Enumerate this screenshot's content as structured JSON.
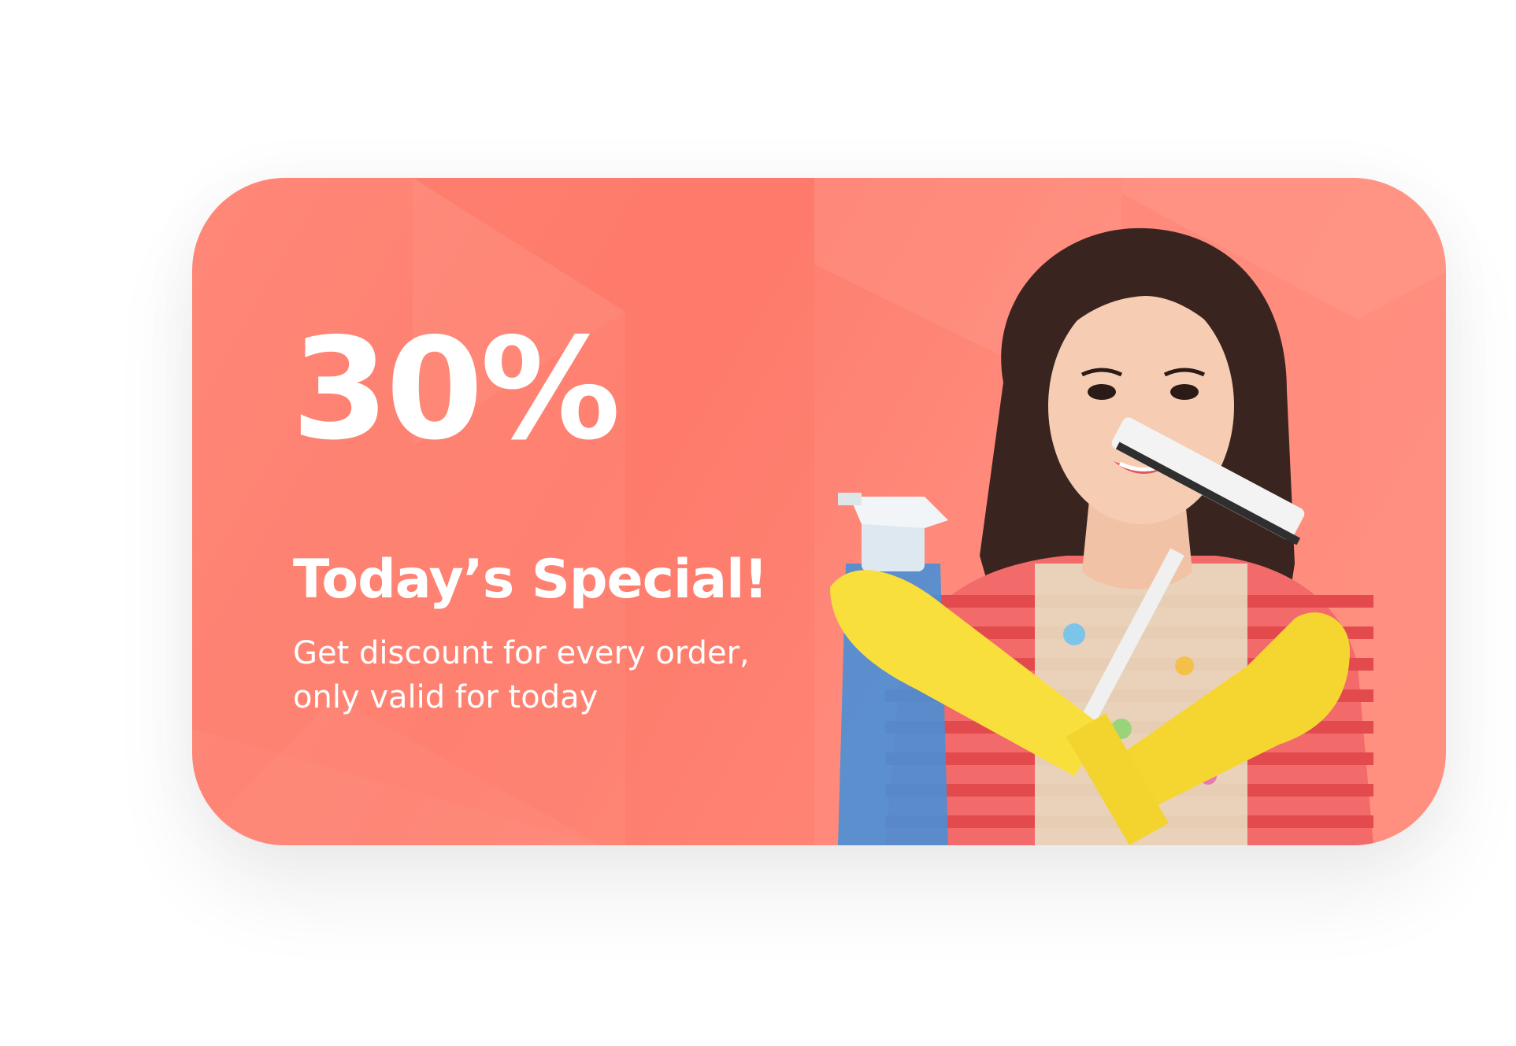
{
  "promo": {
    "discount": "30%",
    "headline": "Today’s Special!",
    "description": "Get discount for every order, only valid for today",
    "photo_alt": "woman in striped shirt and yellow gloves holding spray bottle and squeegee"
  },
  "colors": {
    "card_background": "#fd7d6e",
    "text": "#ffffff",
    "glove": "#f9df3c",
    "stripe": "#e9504f",
    "bottle": "#4a8fd6"
  }
}
